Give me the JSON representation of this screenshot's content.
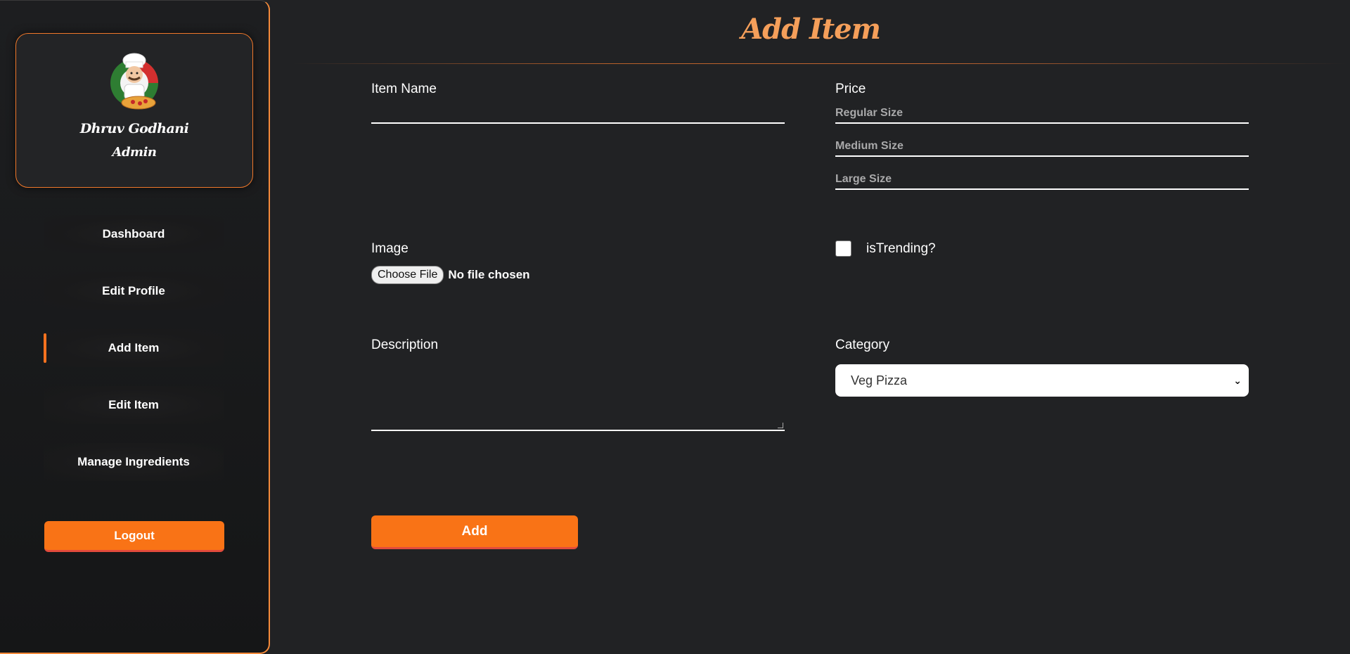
{
  "sidebar": {
    "profile": {
      "name": "Dhruv Godhani",
      "role": "Admin"
    },
    "items": [
      {
        "label": "Dashboard",
        "active": false
      },
      {
        "label": "Edit Profile",
        "active": false
      },
      {
        "label": "Add Item",
        "active": true
      },
      {
        "label": "Edit Item",
        "active": false
      },
      {
        "label": "Manage Ingredients",
        "active": false
      }
    ],
    "logout_label": "Logout"
  },
  "main": {
    "title": "Add Item",
    "form": {
      "item_name": {
        "label": "Item Name",
        "value": ""
      },
      "price": {
        "label": "Price",
        "regular_placeholder": "Regular Size",
        "medium_placeholder": "Medium Size",
        "large_placeholder": "Large Size"
      },
      "image": {
        "label": "Image",
        "button": "Choose File",
        "status": "No file chosen"
      },
      "trending": {
        "label": "isTrending?",
        "checked": false
      },
      "description": {
        "label": "Description",
        "value": ""
      },
      "category": {
        "label": "Category",
        "selected": "Veg Pizza"
      },
      "submit_label": "Add"
    }
  },
  "colors": {
    "accent": "#f97316",
    "title": "#f59f5a",
    "background": "#212224"
  }
}
